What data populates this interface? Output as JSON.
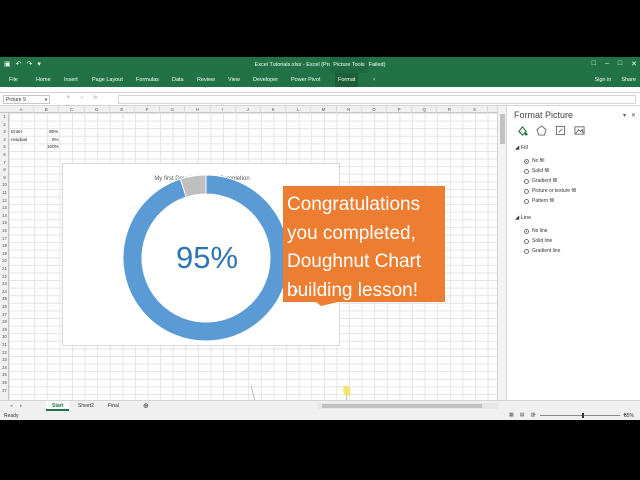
{
  "titlebar": {
    "title": "Excel Tutorials.xlsx - Excel (Product Activation Failed)",
    "picture_tools": "Picture Tools",
    "qat": [
      "▣",
      "↶",
      "↷",
      "▾"
    ],
    "win": [
      "□",
      "–",
      "□",
      "✕"
    ]
  },
  "ribbon": {
    "tabs": [
      "File",
      "Home",
      "Insert",
      "Page Layout",
      "Formulas",
      "Data",
      "Review",
      "View",
      "Developer",
      "Power Pivot",
      "Format"
    ],
    "tell": "♀",
    "signin": "Sign in",
    "share": "Share"
  },
  "formula_bar": {
    "name_box": "Picture 9",
    "buttons": [
      "✕",
      "✓",
      "fx"
    ]
  },
  "columns": [
    "A",
    "B",
    "C",
    "D",
    "E",
    "F",
    "G",
    "H",
    "I",
    "J",
    "K",
    "L",
    "M",
    "N",
    "O",
    "P",
    "Q",
    "R",
    "S"
  ],
  "rows": [
    "1",
    "2",
    "3",
    "4",
    "5",
    "6",
    "7",
    "8",
    "9",
    "10",
    "11",
    "12",
    "13",
    "14",
    "15",
    "16",
    "17",
    "18",
    "19",
    "20",
    "21",
    "22",
    "23",
    "24",
    "25",
    "26",
    "27",
    "28",
    "29",
    "30",
    "31",
    "32",
    "33",
    "34",
    "35",
    "36",
    "37"
  ],
  "cells": {
    "a3": "Enter",
    "a4": "residual",
    "b3": "95%",
    "b4": "5%",
    "b5": "100%"
  },
  "chart": {
    "title": "My first Doughnut Chart Completion",
    "center_label": "95%",
    "colors": {
      "main": "#5b9bd5",
      "rest": "#bfbfbf"
    }
  },
  "chart_data": {
    "type": "pie",
    "categories": [
      "Enter",
      "residual"
    ],
    "values": [
      95,
      5
    ],
    "title": "My first Doughnut Chart Completion"
  },
  "callout": {
    "lines": [
      "Congratulations",
      "you completed,",
      "Doughnut Chart",
      "building lesson!"
    ],
    "color": "#ed7d31"
  },
  "format_pane": {
    "title": "Format Picture",
    "controls": [
      "▾",
      "✕"
    ],
    "fill_header": "Fill",
    "fill_options": [
      "No fill",
      "Solid fill",
      "Gradient fill",
      "Picture or texture fill",
      "Pattern fill"
    ],
    "line_header": "Line",
    "line_options": [
      "No line",
      "Solid line",
      "Gradient line"
    ]
  },
  "sheets": [
    "Start",
    "Sheet2",
    "Final"
  ],
  "add_sheet": "⊕",
  "status": {
    "ready": "Ready",
    "zoom": "85%",
    "view_icons": [
      "▦",
      "▤",
      "▥",
      "–",
      "+"
    ]
  },
  "accent": "#217346"
}
